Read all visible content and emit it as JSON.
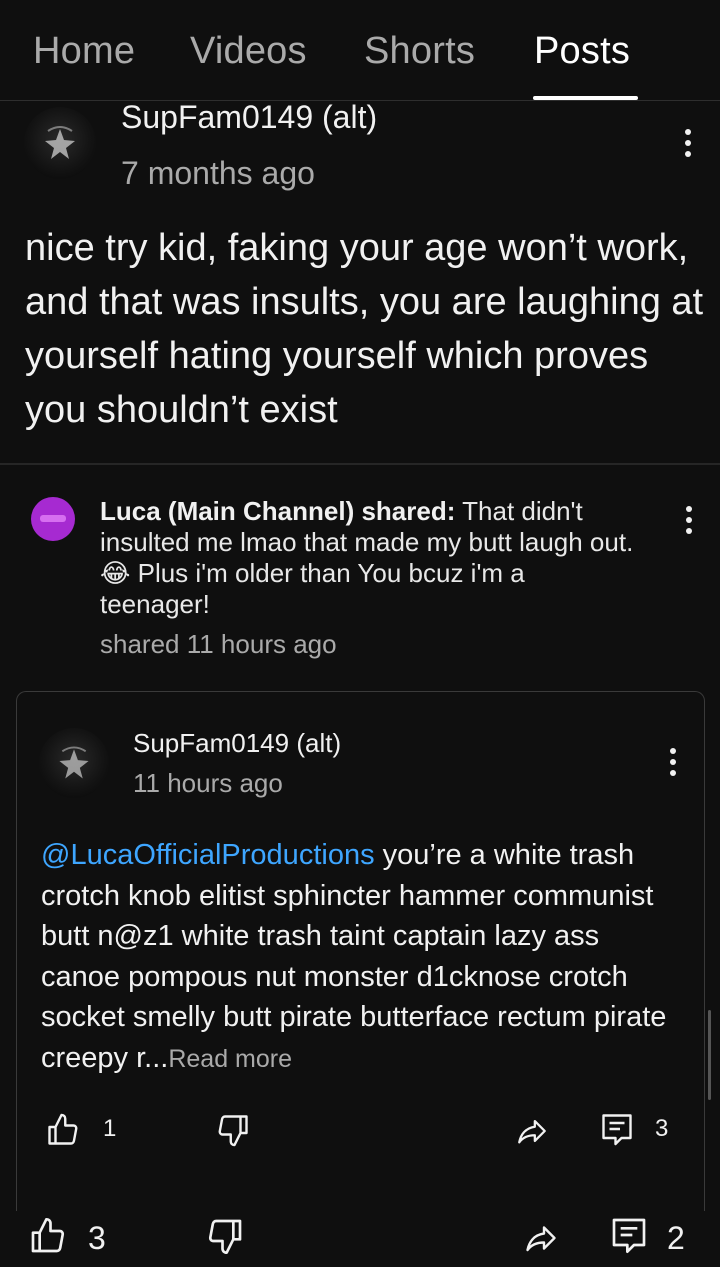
{
  "tabs": [
    {
      "label": "Home",
      "active": false
    },
    {
      "label": "Videos",
      "active": false
    },
    {
      "label": "Shorts",
      "active": false
    },
    {
      "label": "Posts",
      "active": true
    }
  ],
  "post": {
    "author": "SupFam0149 (alt)",
    "time": "7 months ago",
    "body": "nice try kid, faking your age won’t work, and that was insults, you are laughing at yourself hating yourself which proves you shouldn’t exist",
    "likes": "3",
    "comments": "2"
  },
  "share": {
    "name": "Luca (Main Channel) shared:",
    "text": "That didn't insulted me lmao that made my butt laugh out. 😂 Plus i'm older than You bcuz i'm a teenager!",
    "time": "shared 11 hours ago",
    "avatar_color": "#a62ad1"
  },
  "shared_post": {
    "author": "SupFam0149 (alt)",
    "time": "11 hours ago",
    "mention": "@LucaOfficialProductions",
    "body": "you’re a white trash crotch knob elitist sphincter hammer communist butt n@z1 white trash taint captain lazy ass canoe pompous nut monster d1cknose crotch socket smelly butt pirate butterface rectum pirate creepy r...",
    "read_more": "Read more",
    "likes": "1",
    "comments": "3"
  },
  "colors": {
    "background": "#0f0f0f",
    "text": "#f1f1f1",
    "secondary_text": "#aaaaaa",
    "mention": "#3ea6ff"
  },
  "icons": [
    "like-icon",
    "dislike-icon",
    "share-icon",
    "comment-icon",
    "more-vert-icon"
  ]
}
